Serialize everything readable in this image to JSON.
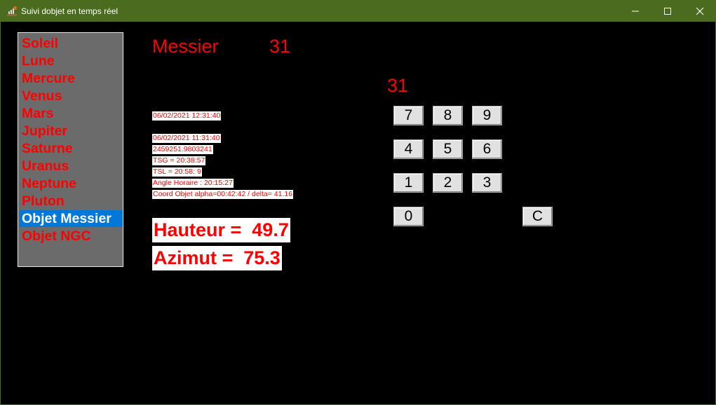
{
  "window": {
    "title": "Suivi dobjet en temps réel",
    "icon": "telescope-icon"
  },
  "object_list": {
    "items": [
      {
        "label": "Soleil"
      },
      {
        "label": "Lune"
      },
      {
        "label": "Mercure"
      },
      {
        "label": "Venus"
      },
      {
        "label": "Mars"
      },
      {
        "label": "Jupiter"
      },
      {
        "label": "Saturne"
      },
      {
        "label": "Uranus"
      },
      {
        "label": "Neptune"
      },
      {
        "label": "Pluton"
      },
      {
        "label": "Objet Messier"
      },
      {
        "label": "Objet NGC"
      }
    ],
    "selected": "Objet Messier"
  },
  "selection": {
    "catalog_label": "Messier",
    "number": "31",
    "entry_display": "31"
  },
  "info": {
    "local_datetime": "06/02/2021 12:31:40",
    "utc_datetime": "06/02/2021 11:31:40",
    "julian_day": "2459251.9803241",
    "tsg": "TSG = 20:38:57",
    "tsl": "TSL = 20:58: 9",
    "hour_angle": "Angle Horaire : 20:15:27",
    "coords": "Coord Objet alpha=00:42:42 / delta= 41.16"
  },
  "result": {
    "altitude": "Hauteur =  49.7",
    "azimuth": "Azimut =  75.3"
  },
  "keypad": {
    "k7": "7",
    "k8": "8",
    "k9": "9",
    "k4": "4",
    "k5": "5",
    "k6": "6",
    "k1": "1",
    "k2": "2",
    "k3": "3",
    "k0": "0",
    "clear": "C"
  },
  "colors": {
    "titlebar": "#4b6c1f",
    "background": "#000000",
    "text_red": "#ff0000",
    "selection_blue": "#0078d7",
    "list_bg": "#6b6b6b"
  }
}
